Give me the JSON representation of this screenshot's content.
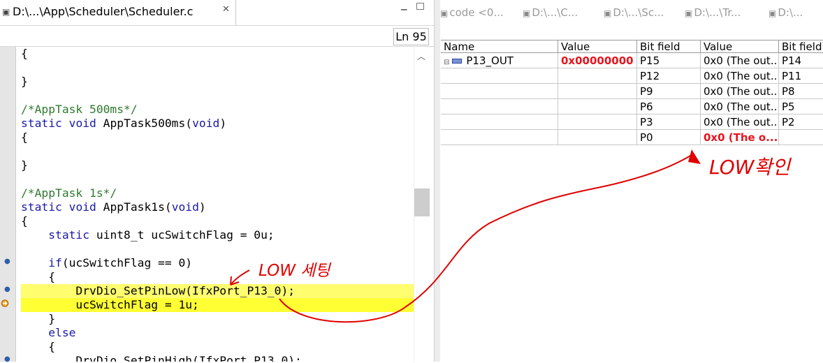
{
  "editor": {
    "tab_icon": "c-file-icon",
    "tab_title": "D:\\...\\App\\Scheduler\\Scheduler.c",
    "tab_close": "✕",
    "line_indicator": "Ln 95",
    "code_lines": [
      {
        "parts": [
          [
            "t",
            "{"
          ]
        ]
      },
      {
        "parts": [
          [
            "t",
            ""
          ]
        ]
      },
      {
        "parts": [
          [
            "t",
            "}"
          ]
        ]
      },
      {
        "parts": [
          [
            "t",
            ""
          ]
        ]
      },
      {
        "parts": [
          [
            "c",
            "/*AppTask 500ms*/"
          ]
        ]
      },
      {
        "parts": [
          [
            "k",
            "static"
          ],
          [
            "t",
            " "
          ],
          [
            "k",
            "void"
          ],
          [
            "t",
            " AppTask500ms("
          ],
          [
            "k",
            "void"
          ],
          [
            "t",
            ")"
          ]
        ]
      },
      {
        "parts": [
          [
            "t",
            "{"
          ]
        ]
      },
      {
        "parts": [
          [
            "t",
            ""
          ]
        ]
      },
      {
        "parts": [
          [
            "t",
            "}"
          ]
        ]
      },
      {
        "parts": [
          [
            "t",
            ""
          ]
        ]
      },
      {
        "parts": [
          [
            "c",
            "/*AppTask 1s*/"
          ]
        ]
      },
      {
        "parts": [
          [
            "k",
            "static"
          ],
          [
            "t",
            " "
          ],
          [
            "k",
            "void"
          ],
          [
            "t",
            " AppTask1s("
          ],
          [
            "k",
            "void"
          ],
          [
            "t",
            ")"
          ]
        ]
      },
      {
        "parts": [
          [
            "t",
            "{"
          ]
        ]
      },
      {
        "parts": [
          [
            "t",
            "    "
          ],
          [
            "k",
            "static"
          ],
          [
            "t",
            " uint8_t ucSwitchFlag = 0u;"
          ]
        ]
      },
      {
        "parts": [
          [
            "t",
            ""
          ]
        ]
      },
      {
        "parts": [
          [
            "t",
            "    "
          ],
          [
            "k",
            "if"
          ],
          [
            "t",
            "(ucSwitchFlag == 0)"
          ]
        ]
      },
      {
        "parts": [
          [
            "t",
            "    {"
          ]
        ]
      },
      {
        "parts": [
          [
            "t",
            "        DrvDio_SetPinLow(IfxPort_P13_0);"
          ]
        ],
        "style": "hl"
      },
      {
        "parts": [
          [
            "t",
            "        ucSwitchFlag = 1u;"
          ]
        ],
        "style": "current"
      },
      {
        "parts": [
          [
            "t",
            "    }"
          ]
        ]
      },
      {
        "parts": [
          [
            "t",
            "    "
          ],
          [
            "k",
            "else"
          ]
        ]
      },
      {
        "parts": [
          [
            "t",
            "    {"
          ]
        ]
      },
      {
        "parts": [
          [
            "t",
            "        DrvDio_SetPinHigh(IfxPort_P13_0);"
          ]
        ]
      }
    ]
  },
  "right_tabs": [
    {
      "icon": "variables-icon",
      "label": "code <0..."
    },
    {
      "icon": "c-file-icon",
      "label": "D:\\...\\C..."
    },
    {
      "icon": "c-file-icon",
      "label": "D:\\...\\Sc..."
    },
    {
      "icon": "c-file-icon",
      "label": "D:\\...\\Tr..."
    },
    {
      "icon": "c-file-icon",
      "label": "D:\\..."
    }
  ],
  "register_table": {
    "headers": [
      "Name",
      "Value",
      "Bit field",
      "Value",
      "Bit field"
    ],
    "register_name": "P13_OUT",
    "register_value": "0x00000000",
    "rows": [
      {
        "bit_a": "P15",
        "val": "0x0 (The out...",
        "bit_b": "P14",
        "red": false
      },
      {
        "bit_a": "P12",
        "val": "0x0 (The out...",
        "bit_b": "P11",
        "red": false
      },
      {
        "bit_a": "P9",
        "val": "0x0 (The out...",
        "bit_b": "P8",
        "red": false
      },
      {
        "bit_a": "P6",
        "val": "0x0 (The out...",
        "bit_b": "P5",
        "red": false
      },
      {
        "bit_a": "P3",
        "val": "0x0 (The out...",
        "bit_b": "P2",
        "red": false
      },
      {
        "bit_a": "P0",
        "val": "0x0 (The o...",
        "bit_b": "",
        "red": true
      }
    ]
  },
  "annotations": {
    "set_low": "LOW 세팅",
    "check_low": "LOW확인",
    "color": "#e00000"
  },
  "colors": {
    "keyword": "#1a1aa6",
    "comment": "#2f7a2f",
    "current_line": "#ffff33",
    "value_red": "#e8141e"
  }
}
